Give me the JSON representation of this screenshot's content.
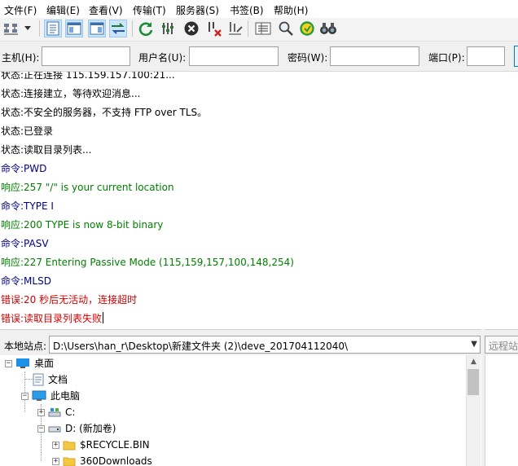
{
  "menu": [
    {
      "label": "文件(F)"
    },
    {
      "label": "编辑(E)"
    },
    {
      "label": "查看(V)"
    },
    {
      "label": "传输(T)"
    },
    {
      "label": "服务器(S)"
    },
    {
      "label": "书签(B)"
    },
    {
      "label": "帮助(H)"
    }
  ],
  "toolbar": {
    "icons": [
      "site-manager-icon",
      "dropdown-arrow-icon",
      "toggle-message-log-icon",
      "toggle-local-tree-icon",
      "toggle-remote-tree-icon",
      "toggle-transfer-queue-icon",
      "refresh-icon",
      "process-queue-icon",
      "cancel-icon",
      "disconnect-icon",
      "reconnect-icon",
      "directory-listing-filters-icon",
      "search-files-icon",
      "synchronized-browsing-icon",
      "compare-directories-icon"
    ]
  },
  "quickconnect": {
    "host_label": "主机(H):",
    "user_label": "用户名(U):",
    "pass_label": "密码(W):",
    "port_label": "端口(P):",
    "host_value": "",
    "user_value": "",
    "pass_value": "",
    "port_value": ""
  },
  "log": [
    {
      "text": "状态:\t正在连接 115.159.157.100:21...",
      "type": "status"
    },
    {
      "text": "状态:\t连接建立，等待欢迎消息...",
      "type": "status"
    },
    {
      "text": "状态:\t不安全的服务器，不支持 FTP over TLS。",
      "type": "status"
    },
    {
      "text": "状态:\t已登录",
      "type": "status"
    },
    {
      "text": "状态:\t读取目录列表...",
      "type": "status"
    },
    {
      "text": "命令:\tPWD",
      "type": "cmd"
    },
    {
      "text": "响应:\t257 \"/\" is your current location",
      "type": "resp"
    },
    {
      "text": "命令:\tTYPE I",
      "type": "cmd"
    },
    {
      "text": "响应:\t200 TYPE is now 8-bit binary",
      "type": "resp"
    },
    {
      "text": "命令:\tPASV",
      "type": "cmd"
    },
    {
      "text": "响应:\t227 Entering Passive Mode (115,159,157,100,148,254)",
      "type": "resp"
    },
    {
      "text": "命令:\tMLSD",
      "type": "cmd"
    },
    {
      "text": "错误:\t20 秒后无活动，连接超时",
      "type": "err"
    },
    {
      "text": "错误:\t读取目录列表失败",
      "type": "err"
    }
  ],
  "local": {
    "label": "本地站点:",
    "path": "D:\\Users\\han_r\\Desktop\\新建文件夹 (2)\\deve_201704112040\\"
  },
  "tree": [
    {
      "label": "桌面",
      "icon": "desktop-icon"
    },
    {
      "label": "文档",
      "icon": "document-icon"
    },
    {
      "label": "此电脑",
      "icon": "computer-icon"
    },
    {
      "label": "C:",
      "icon": "network-drive-icon"
    },
    {
      "label": "D: (新加卷)",
      "icon": "disk-drive-icon"
    },
    {
      "label": "$RECYCLE.BIN",
      "icon": "folder-icon"
    },
    {
      "label": "360Downloads",
      "icon": "folder-icon"
    }
  ],
  "remote": {
    "label": "远程站点:"
  }
}
